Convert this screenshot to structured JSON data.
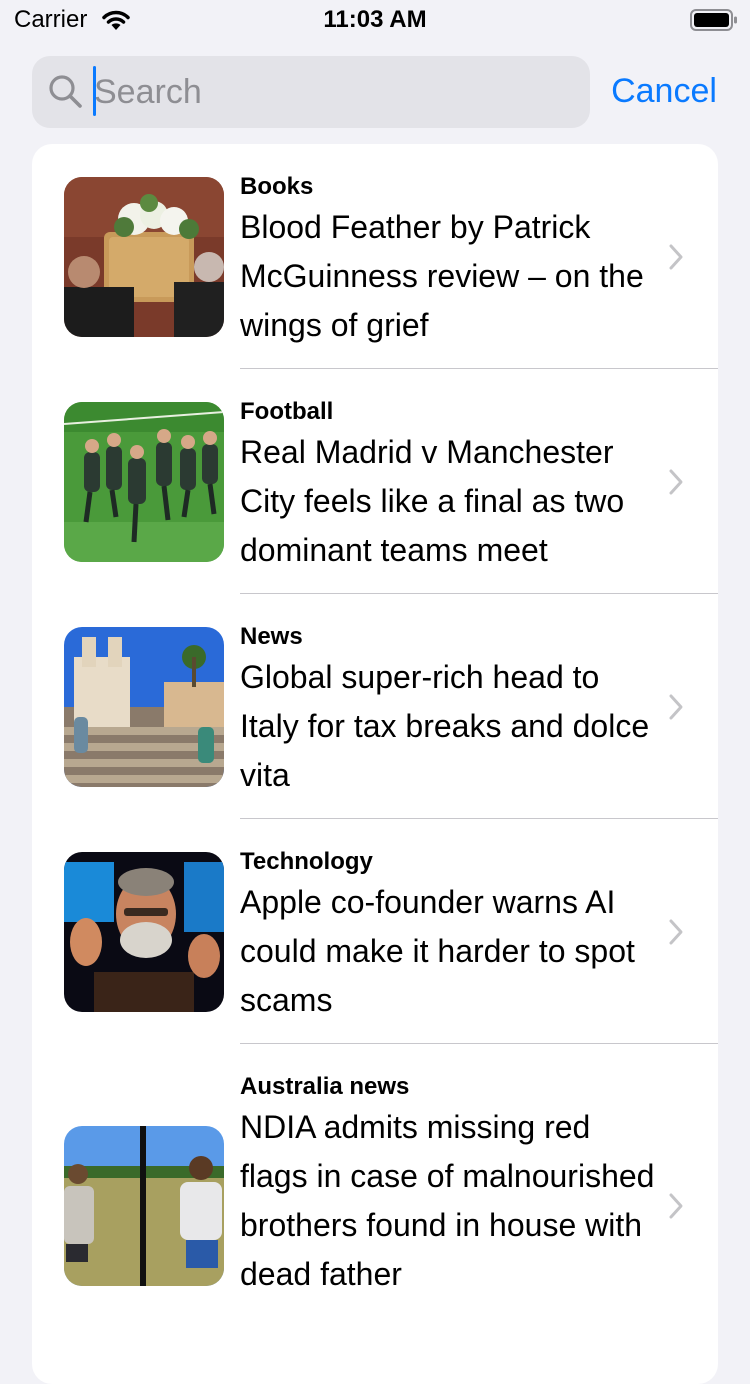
{
  "status_bar": {
    "carrier": "Carrier",
    "time": "11:03 AM",
    "wifi_icon": "wifi-icon",
    "battery_icon": "battery-icon"
  },
  "search": {
    "placeholder": "Search",
    "value": "",
    "cancel_label": "Cancel"
  },
  "colors": {
    "accent": "#0a7aff",
    "background": "#f2f2f7",
    "card": "#ffffff",
    "separator": "#c8c7cc",
    "chevron": "#c4c4c7"
  },
  "results": [
    {
      "section": "Books",
      "headline": "Blood Feather by Patrick McGuinness review – on the wings of grief",
      "image": "funeral-coffin-photo"
    },
    {
      "section": "Football",
      "headline": "Real Madrid v Manchester City feels like a final as two dominant teams meet",
      "image": "football-training-photo"
    },
    {
      "section": "News",
      "headline": "Global super-rich head to Italy for tax breaks and dolce vita",
      "image": "spanish-steps-rome-photo"
    },
    {
      "section": "Technology",
      "headline": "Apple co-founder warns AI could make it harder to spot scams",
      "image": "speaker-on-stage-photo"
    },
    {
      "section": "Australia news",
      "headline": "NDIA admits missing red flags in case of malnourished brothers found in house with dead father",
      "image": "two-boys-in-field-photo"
    }
  ]
}
